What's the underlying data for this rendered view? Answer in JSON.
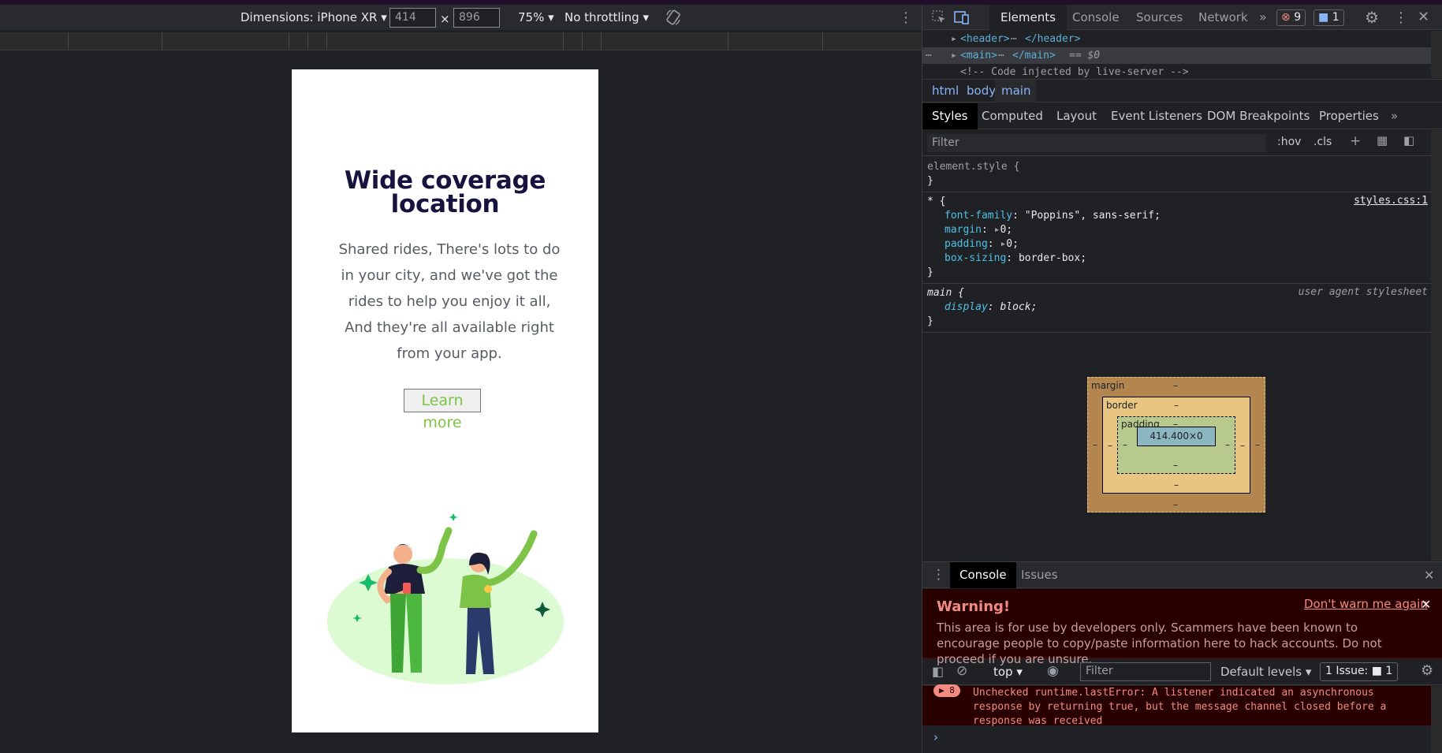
{
  "device_toolbar": {
    "dimensions_label": "Dimensions: iPhone XR ▾",
    "width": "414",
    "x": "×",
    "height": "896",
    "zoom": "75% ▾",
    "throttling": "No throttling ▾"
  },
  "page": {
    "title_line1": "Wide coverage",
    "title_line2": "location",
    "description": "Shared rides, There's lots to do in your city, and we've got the rides to help you enjoy it all, And they're all available right from your app.",
    "button_label": "Learn more"
  },
  "devtools": {
    "tabs": [
      "Elements",
      "Console",
      "Sources",
      "Network"
    ],
    "error_count": "9",
    "message_count": "1",
    "dom": {
      "header": "<header>",
      "header_close": "</header>",
      "main": "<main>",
      "main_close": "</main>",
      "main_suffix": "== $0",
      "comment": "<!-- Code injected by live-server -->"
    },
    "breadcrumbs": [
      "html",
      "body",
      "main"
    ],
    "style_tabs": [
      "Styles",
      "Computed",
      "Layout",
      "Event Listeners",
      "DOM Breakpoints",
      "Properties"
    ],
    "filter_placeholder": "Filter",
    "hov": ":hov",
    "cls": ".cls",
    "element_style": "element.style {",
    "rule1": {
      "selector": "* {",
      "source": "styles.css:1",
      "props": [
        {
          "name": "font-family",
          "value": "\"Poppins\", sans-serif;"
        },
        {
          "name": "margin",
          "value": "0;"
        },
        {
          "name": "padding",
          "value": "0;"
        },
        {
          "name": "box-sizing",
          "value": "border-box;"
        }
      ]
    },
    "rule2": {
      "selector": "main {",
      "source": "user agent stylesheet",
      "prop_name": "display",
      "prop_value": "block;"
    },
    "close_brace": "}",
    "box_model": {
      "margin": "margin",
      "border": "border",
      "padding": "padding",
      "content": "414.400×0",
      "dash": "–"
    },
    "drawer_tabs": [
      "Console",
      "Issues"
    ],
    "warning": {
      "title": "Warning!",
      "link": "Don't warn me again",
      "text": "This area is for use by developers only. Scammers have been known to encourage people to copy/paste information here to hack accounts. Do not proceed if you are unsure."
    },
    "console_toolbar": {
      "context": "top ▾",
      "filter_placeholder": "Filter",
      "levels": "Default levels ▾",
      "issues": "1 Issue: ■ 1"
    },
    "console_message": {
      "count": "▶ 8",
      "text": "Unchecked runtime.lastError: A listener indicated an asynchronous response by returning true, but the message channel closed before a response was received"
    }
  },
  "colors": {
    "title": "#16133f",
    "accent_green": "#7cc348",
    "devtools_bg": "#202124"
  }
}
